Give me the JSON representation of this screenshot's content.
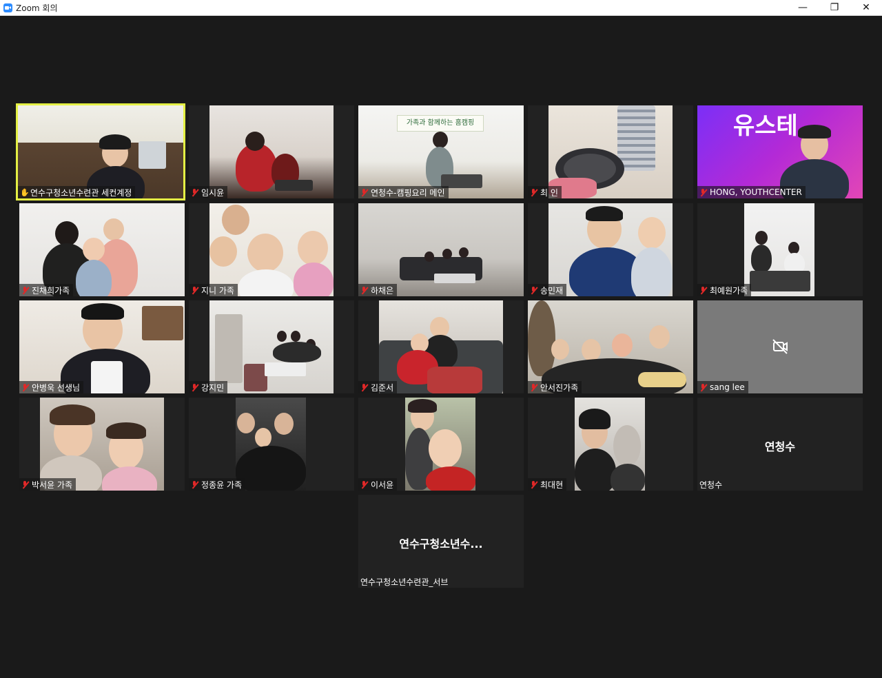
{
  "window": {
    "title": "Zoom 회의",
    "controls": {
      "minimize": "—",
      "restore": "❐",
      "close": "✕"
    }
  },
  "colors": {
    "background": "#1a1a1a",
    "tile": "#222222",
    "active_speaker_border": "#e4f044",
    "muted_mic": "#e02828"
  },
  "participants": [
    {
      "name": "연수구청소년수련관 세컨계정",
      "muted": false,
      "host": true,
      "active": true
    },
    {
      "name": "임시윤",
      "muted": true
    },
    {
      "name": "연청수-캠핑요리 메인",
      "muted": true
    },
    {
      "name": "최 인",
      "muted": true
    },
    {
      "name": "HONG, YOUTHCENTER",
      "muted": true
    },
    {
      "name": "진채희가족",
      "muted": true
    },
    {
      "name": "지니 가족",
      "muted": true
    },
    {
      "name": "하채은",
      "muted": true
    },
    {
      "name": "송민재",
      "muted": true
    },
    {
      "name": "최예원가족",
      "muted": true
    },
    {
      "name": "안병욱 선생님",
      "muted": true
    },
    {
      "name": "강지민",
      "muted": true
    },
    {
      "name": "김준서",
      "muted": true
    },
    {
      "name": "안서진가족",
      "muted": true
    },
    {
      "name": "sang lee",
      "muted": true,
      "video_off": true
    },
    {
      "name": "박서윤 가족",
      "muted": true
    },
    {
      "name": "정종윤 가족",
      "muted": true
    },
    {
      "name": "이서윤",
      "muted": true
    },
    {
      "name": "최대현",
      "muted": true
    },
    {
      "name": "연청수",
      "muted": false,
      "center_label": "연청수"
    },
    {
      "name": "연수구청소년수련관_서브",
      "muted": false,
      "center_label": "연수구청소년수..."
    }
  ],
  "overlay_texts": {
    "tile3_banner": "가족과 함께하는 홈캠핑",
    "tile5_banner": "유스테"
  }
}
